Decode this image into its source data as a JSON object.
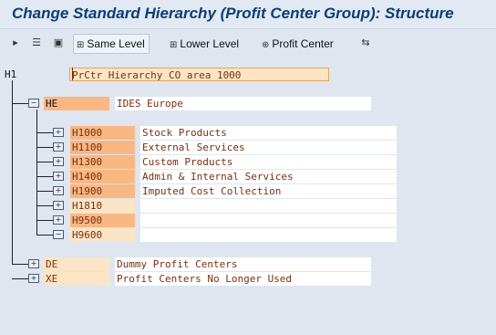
{
  "window": {
    "title": "Change Standard Hierarchy (Profit Center Group): Structure"
  },
  "toolbar": {
    "icons": [
      "insert-icon",
      "delete-icon",
      "select-icon"
    ],
    "same_level": "Same Level",
    "lower_level": "Lower Level",
    "profit_center": "Profit Center",
    "last_icon": "expand-icon"
  },
  "tree": {
    "root": {
      "code": "H1",
      "text": "PrCtr Hierarchy CO area 1000"
    },
    "he": {
      "code": "HE",
      "text": "IDES Europe"
    },
    "children": [
      {
        "code": "H1000",
        "text": "Stock Products"
      },
      {
        "code": "H1100",
        "text": "External Services"
      },
      {
        "code": "H1300",
        "text": "Custom Products"
      },
      {
        "code": "H1400",
        "text": "Admin & Internal Services"
      },
      {
        "code": "H1900",
        "text": "Imputed Cost Collection"
      },
      {
        "code": "H1810",
        "text": ""
      },
      {
        "code": "H9500",
        "text": ""
      },
      {
        "code": "H9600",
        "text": ""
      }
    ],
    "de": {
      "code": "DE",
      "text": "Dummy Profit Centers"
    },
    "xe": {
      "code": "XE",
      "text": "Profit Centers No Longer Used"
    }
  }
}
